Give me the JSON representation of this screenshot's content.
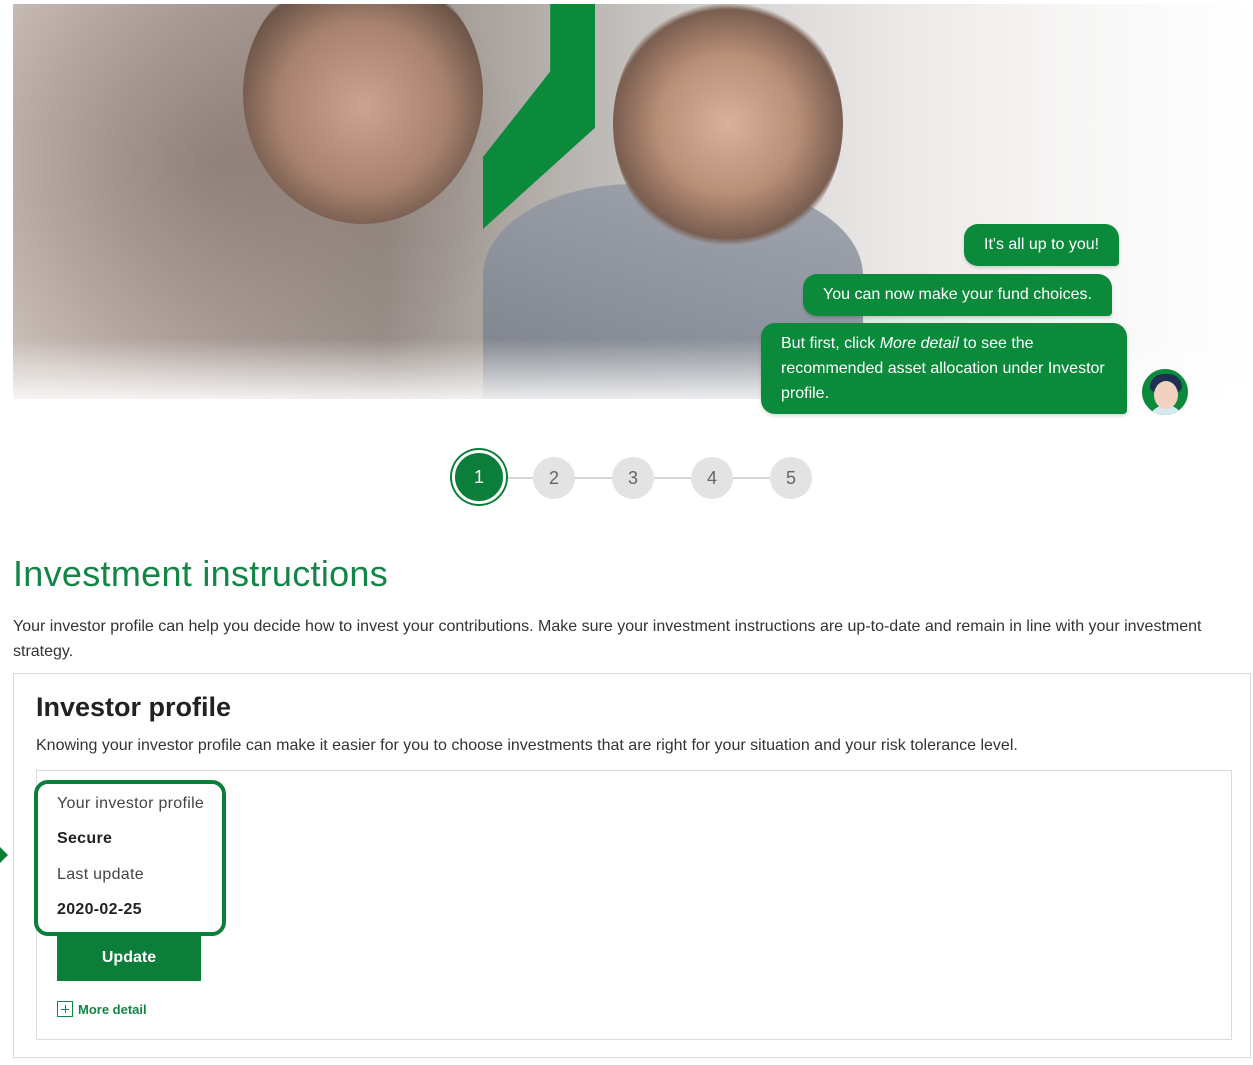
{
  "hero": {
    "bubbles": [
      "It's all up to you!",
      "You can now make your fund choices."
    ],
    "bubble3": {
      "before": "But first, click ",
      "emph": "More detail",
      "after": " to see the recommended asset allocation under Investor profile."
    },
    "avatar_icon": "assistant-avatar",
    "accent_color": "#0b8a3c"
  },
  "stepper": {
    "steps": [
      "1",
      "2",
      "3",
      "4",
      "5"
    ],
    "active": "1"
  },
  "page": {
    "title": "Investment instructions",
    "intro": "Your investor profile can help you decide how to invest your contributions. Make sure your investment instructions are up-to-date and remain in line with your investment strategy."
  },
  "profile_card": {
    "title": "Investor profile",
    "description": "Knowing your investor profile can make it easier for you to choose investments that are right for your situation and your risk tolerance level.",
    "profile_label": "Your investor profile",
    "profile_value": "Secure",
    "update_label": "Last update",
    "update_value": "2020-02-25",
    "update_button": "Update",
    "more_detail": "More detail",
    "more_icon": "plus-square-icon"
  }
}
